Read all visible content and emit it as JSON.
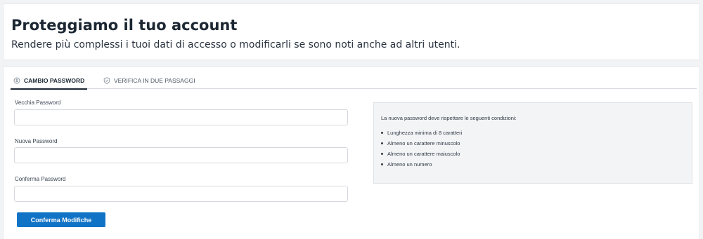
{
  "header": {
    "title": "Proteggiamo il tuo account",
    "subtitle": "Rendere più complessi i tuoi dati di accesso o modificarli se sono noti anche ad altri utenti."
  },
  "tabs": [
    {
      "label": "CAMBIO PASSWORD",
      "icon": "coin-icon",
      "active": true
    },
    {
      "label": "VERIFICA IN DUE PASSAGGI",
      "icon": "shield-check-icon",
      "active": false
    }
  ],
  "form": {
    "old_password": {
      "label": "Vecchia Password",
      "value": ""
    },
    "new_password": {
      "label": "Nuova Password",
      "value": ""
    },
    "confirm_password": {
      "label": "Conferma Password",
      "value": ""
    },
    "submit_label": "Conferma Modifiche"
  },
  "rules": {
    "intro": "La nuova password deve rispettare le seguenti condizioni:",
    "items": [
      "Lunghezza minima di 8 caratteri",
      "Almeno un carattere minuscolo",
      "Almeno un carattere maiuscolo",
      "Almeno un numero"
    ]
  },
  "colors": {
    "accent": "#1173c6",
    "background": "#f2f3f5",
    "text": "#1c2733"
  }
}
